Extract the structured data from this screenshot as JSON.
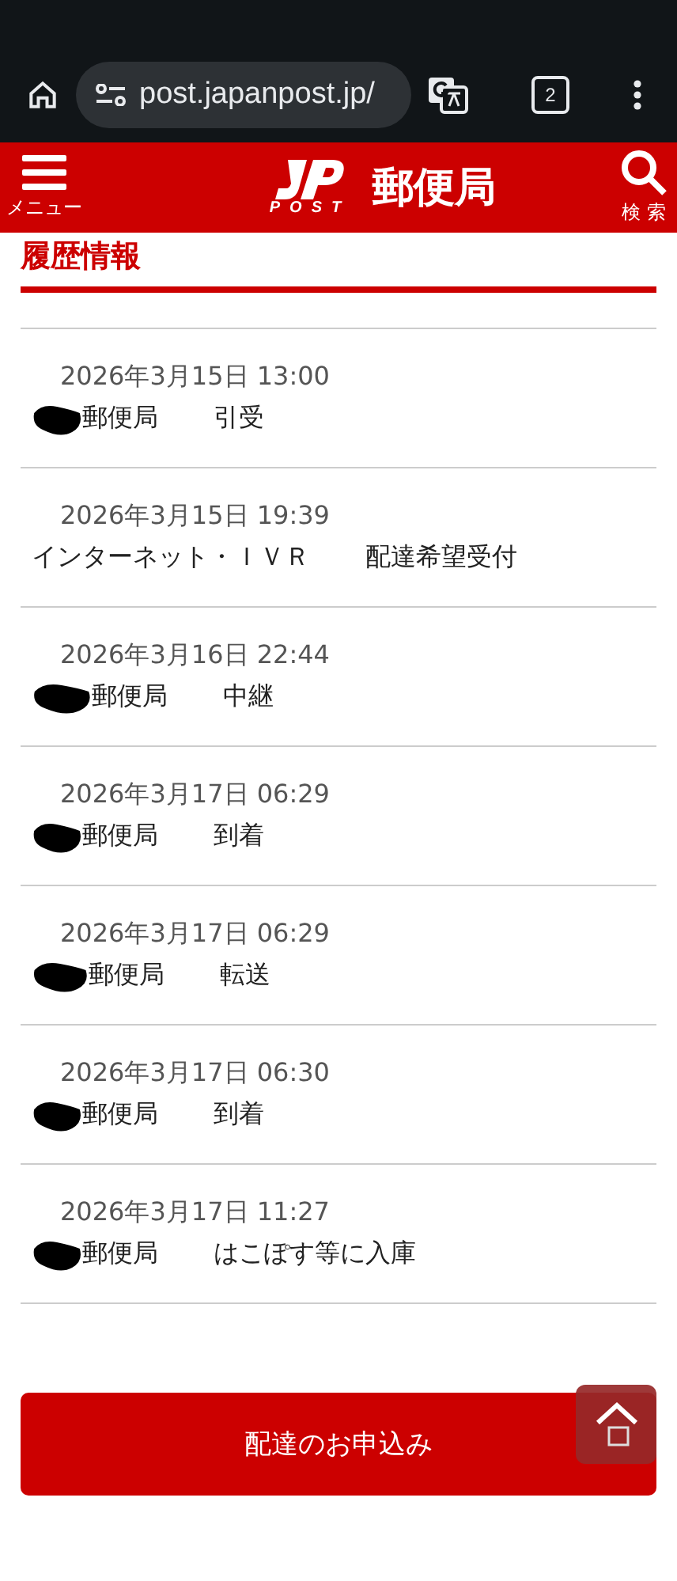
{
  "browser": {
    "url": "post.japanpost.jp/",
    "tab_count": "2"
  },
  "header": {
    "menu_label": "メニュー",
    "logo_text": "POST",
    "title": "郵便局",
    "search_label": "検 索"
  },
  "section": {
    "title": "履歴情報"
  },
  "history": [
    {
      "date": "2026年3月15日 13:00",
      "place": "郵便局",
      "status": "引受",
      "redacted": true
    },
    {
      "date": "2026年3月15日 19:39",
      "place": "インターネット・ＩＶＲ",
      "status": "配達希望受付",
      "redacted": false
    },
    {
      "date": "2026年3月16日 22:44",
      "place": "郵便局",
      "status": "中継",
      "redacted": true
    },
    {
      "date": "2026年3月17日 06:29",
      "place": "郵便局",
      "status": "到着",
      "redacted": true
    },
    {
      "date": "2026年3月17日 06:29",
      "place": "郵便局",
      "status": "転送",
      "redacted": true
    },
    {
      "date": "2026年3月17日 06:30",
      "place": "郵便局",
      "status": "到着",
      "redacted": true
    },
    {
      "date": "2026年3月17日 11:27",
      "place": "郵便局",
      "status": "はこぽす等に入庫",
      "redacted": true
    }
  ],
  "action_button": {
    "label": "配達のお申込み"
  }
}
